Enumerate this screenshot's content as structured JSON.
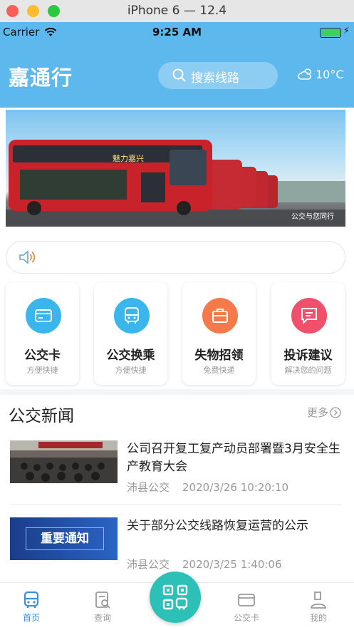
{
  "simulator": {
    "title": "iPhone 6 — 12.4"
  },
  "status_bar": {
    "carrier": "Carrier",
    "time": "9:25 AM"
  },
  "header": {
    "app_title": "嘉通行",
    "search_placeholder": "搜索线路",
    "weather": "10°C"
  },
  "banner": {
    "bus_text": "魅力嘉兴",
    "watermark": "公交与您同行"
  },
  "services": [
    {
      "name": "公交卡",
      "sub": "方便快捷",
      "color": "#3bb6ec"
    },
    {
      "name": "公交换乘",
      "sub": "方便快捷",
      "color": "#3bb6ec"
    },
    {
      "name": "失物招领",
      "sub": "免费快递",
      "color": "#f47a4c"
    },
    {
      "name": "投诉建议",
      "sub": "解决您的问题",
      "color": "#f0506a"
    }
  ],
  "news": {
    "title": "公交新闻",
    "more": "更多",
    "items": [
      {
        "headline": "公司召开复工复产动员部署暨3月安全生产教育大会",
        "source": "沛县公交",
        "time": "2020/3/26 10:20:10"
      },
      {
        "headline": "关于部分公交线路恢复运营的公示",
        "source": "沛县公交",
        "time": "2020/3/25 1:40:06",
        "thumb_text": "重要通知"
      }
    ]
  },
  "tabbar": {
    "home": "首页",
    "query": "查询",
    "card": "公交卡",
    "mine": "我的"
  }
}
